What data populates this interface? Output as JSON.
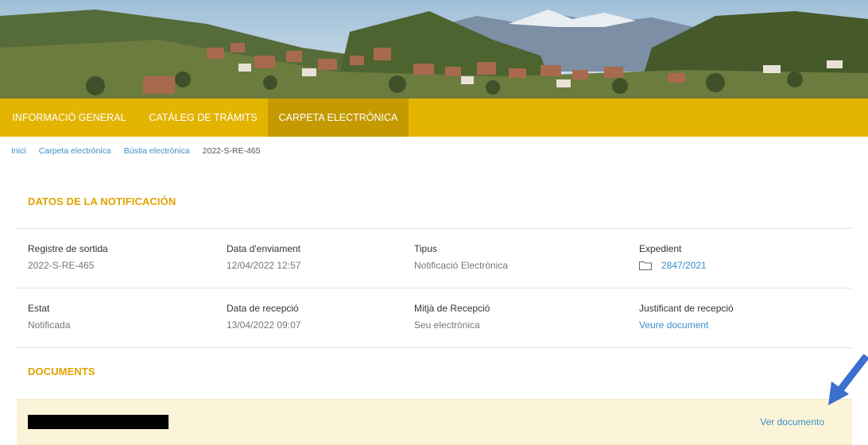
{
  "nav": {
    "items": [
      {
        "label": "INFORMACIÓ GENERAL",
        "active": false
      },
      {
        "label": "CATÀLEG DE TRÀMITS",
        "active": false
      },
      {
        "label": "CARPETA ELECTRÒNICA",
        "active": true
      }
    ],
    "bar_color": "#e3b400",
    "active_color": "#c59a00"
  },
  "breadcrumb": [
    "Inici",
    "Carpeta electrònica",
    "Bústia electrònica",
    "2022-S-RE-465"
  ],
  "notification": {
    "title": "DATOS DE LA NOTIFICACIÓN",
    "rows": [
      [
        {
          "label": "Registre de sortida",
          "value": "2022-S-RE-465"
        },
        {
          "label": "Data d'enviament",
          "value": "12/04/2022 12:57"
        },
        {
          "label": "Tipus",
          "value": "Notificació Electrònica"
        },
        {
          "label": "Expedient",
          "value": "2847/2021",
          "icon": "folder-icon"
        }
      ],
      [
        {
          "label": "Estat",
          "value": "Notificada"
        },
        {
          "label": "Data de recepció",
          "value": "13/04/2022 09:07"
        },
        {
          "label": "Mitjà de Recepció",
          "value": "Seu electrònica"
        },
        {
          "label": "Justificant de recepció",
          "value": "Veure document"
        }
      ]
    ]
  },
  "documents": {
    "title": "DOCUMENTS",
    "items": [
      {
        "name_redacted": true,
        "action_label": "Ver documento"
      }
    ]
  },
  "colors": {
    "accent": "#e0a400",
    "link": "#3a8fc7",
    "doc_row_bg": "#fcf4d8",
    "annotation_arrow": "#3b6fd0"
  }
}
